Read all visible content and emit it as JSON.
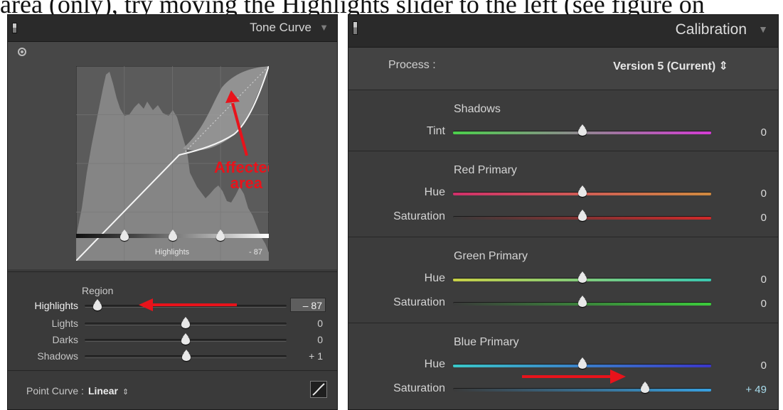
{
  "caption": {
    "text": "area (only), try moving the Highlights slider to the left (see figure on"
  },
  "tone_curve": {
    "title": "Tone Curve",
    "collapse_glyph": "▼",
    "target_icon": "target-adjust-icon",
    "chart_label": "Highlights",
    "chart_value": "- 87",
    "annotation": "Affected area",
    "region_label": "Region",
    "split_points": [
      0.25,
      0.5,
      0.75
    ],
    "rows": [
      {
        "label": "Highlights",
        "value": "– 87",
        "level": 0.065,
        "active": true
      },
      {
        "label": "Lights",
        "value": "0",
        "level": 0.5,
        "active": false
      },
      {
        "label": "Darks",
        "value": "0",
        "level": 0.5,
        "active": false
      },
      {
        "label": "Shadows",
        "value": "+ 1",
        "level": 0.505,
        "active": false
      }
    ],
    "point_curve_label": "Point Curve :",
    "point_curve_value": "Linear",
    "point_curve_arrow": "⇕",
    "edit_icon": "edit-point-curve-icon"
  },
  "calibration": {
    "title": "Calibration",
    "collapse_glyph": "▼",
    "process_label": "Process :",
    "process_value": "Version 5 (Current) ⇕",
    "groups": [
      {
        "title": "Shadows",
        "rows": [
          {
            "label": "Tint",
            "value": "0",
            "level": 0.5,
            "colors": [
              "#4cd04c",
              "#d43cd4"
            ]
          }
        ]
      },
      {
        "title": "Red Primary",
        "rows": [
          {
            "label": "Hue",
            "value": "0",
            "level": 0.5,
            "colors": [
              "#d0306a",
              "#d08a40"
            ]
          },
          {
            "label": "Saturation",
            "value": "0",
            "level": 0.5,
            "colors": [
              "#3a3a3a",
              "#d02a2a"
            ]
          }
        ]
      },
      {
        "title": "Green Primary",
        "rows": [
          {
            "label": "Hue",
            "value": "0",
            "level": 0.5,
            "colors": [
              "#c8d046",
              "#3ac8b0"
            ]
          },
          {
            "label": "Saturation",
            "value": "0",
            "level": 0.5,
            "colors": [
              "#3a3a3a",
              "#3ccc3c"
            ]
          }
        ]
      },
      {
        "title": "Blue Primary",
        "rows": [
          {
            "label": "Hue",
            "value": "0",
            "level": 0.5,
            "colors": [
              "#3ac8c8",
              "#3a36c8"
            ]
          },
          {
            "label": "Saturation",
            "value": "+ 49",
            "level": 0.745,
            "colors": [
              "#3a3a3a",
              "#38a0e0"
            ],
            "emph": true
          }
        ]
      }
    ]
  },
  "colors": {
    "annotation_red": "#e8131b",
    "panel_bg": "#3a3a3a",
    "header_bg": "#2a2a2a"
  }
}
